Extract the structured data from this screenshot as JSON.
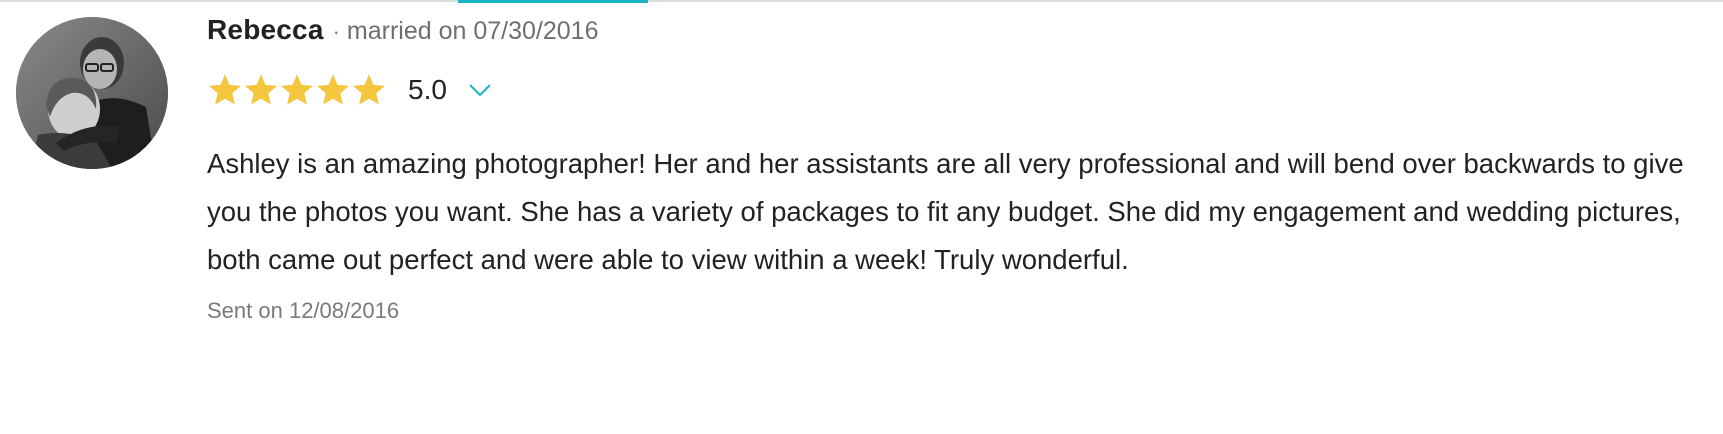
{
  "review": {
    "reviewer_name": "Rebecca",
    "separator": "·",
    "married_text": "married on 07/30/2016",
    "rating": {
      "stars_filled": 5,
      "stars_total": 5,
      "value": "5.0",
      "star_color": "#f4c63d",
      "toggle_icon": "chevron-down-icon",
      "toggle_color": "#19b5c0"
    },
    "body": "Ashley is an amazing photographer! Her and her assistants are all very professional and will bend over backwards to give you the photos you want. She has a variety of packages to fit any budget. She did my engagement and wedding pictures, both came out perfect and were able to view within a week! Truly wonderful.",
    "sent_text": "Sent on 12/08/2016"
  },
  "colors": {
    "accent": "#19b5c0",
    "text_primary": "#222222",
    "text_muted": "#6f6f6f"
  }
}
